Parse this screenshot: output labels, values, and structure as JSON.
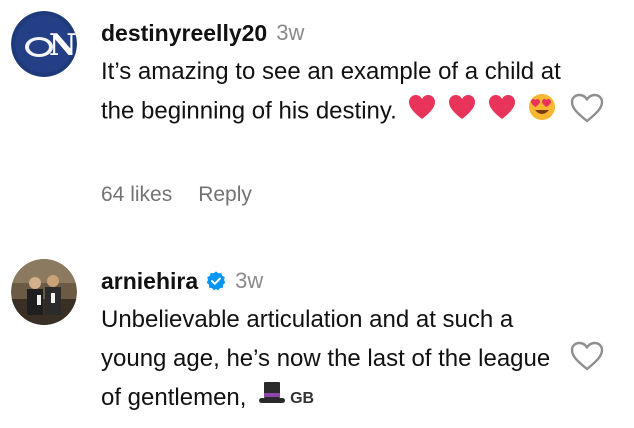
{
  "comments": [
    {
      "username": "destinyreelly20",
      "time": "3w",
      "text": "It’s amazing to see an example of a child at the beginning of his destiny.",
      "likes": "64 likes",
      "reply": "Reply",
      "verified": false,
      "avatar_icon": "ny-yankees-logo-icon",
      "emojis": [
        "heart-icon",
        "heart-icon",
        "heart-icon",
        "heart-eyes-emoji"
      ]
    },
    {
      "username": "arniehira",
      "time": "3w",
      "text": "Unbelievable articulation and at such a young age, he’s now the last of the league of gentlemen,",
      "verified": true,
      "avatar_icon": "profile-photo",
      "trailing_icon": "top-hat-emoji",
      "trailing_label": "GB"
    }
  ],
  "colors": {
    "heart_red": "#e8335a",
    "avatar_navy": "#1e3a7a",
    "verified_blue": "#0095f6",
    "muted_text": "#737373"
  }
}
